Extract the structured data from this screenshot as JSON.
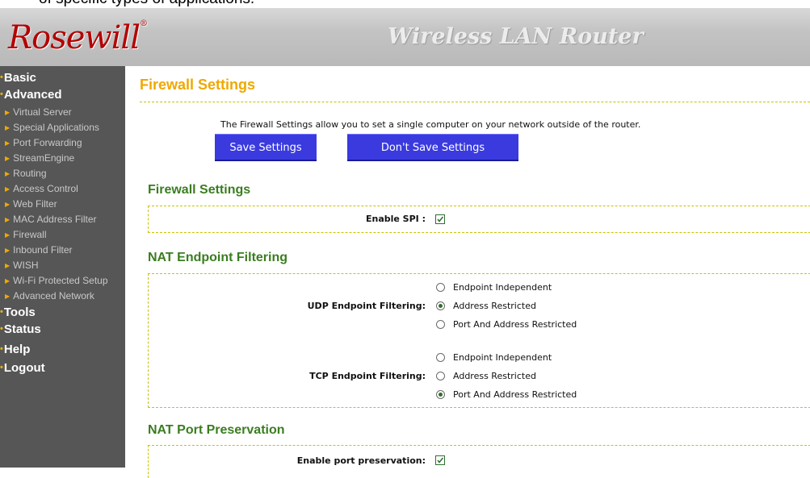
{
  "doc_text": "of specific types of applications.",
  "header": {
    "logo": "Rosewill",
    "logo_mark": "®",
    "title": "Wireless LAN Router"
  },
  "sidebar": {
    "main_items": [
      "Basic",
      "Advanced",
      "Tools",
      "Status",
      "Help",
      "Logout"
    ],
    "sub_items": [
      "Virtual Server",
      "Special Applications",
      "Port Forwarding",
      "StreamEngine",
      "Routing",
      "Access Control",
      "Web Filter",
      "MAC Address Filter",
      "Firewall",
      "Inbound Filter",
      "WISH",
      "Wi-Fi Protected Setup",
      "Advanced Network"
    ]
  },
  "page": {
    "title": "Firewall Settings",
    "description": "The Firewall Settings allow you to set a single computer on your network outside of the router.",
    "save_button": "Save Settings",
    "dont_save_button": "Don't Save Settings"
  },
  "firewall": {
    "heading": "Firewall Settings",
    "spi_label": "Enable SPI :",
    "spi_checked": true
  },
  "nat_filtering": {
    "heading": "NAT Endpoint Filtering",
    "udp_label": "UDP Endpoint Filtering:",
    "tcp_label": "TCP Endpoint Filtering:",
    "options": [
      "Endpoint Independent",
      "Address Restricted",
      "Port And Address Restricted"
    ],
    "udp_selected": "Address Restricted",
    "tcp_selected": "Port And Address Restricted"
  },
  "port_preservation": {
    "heading": "NAT Port Preservation",
    "label": "Enable port preservation:",
    "checked": true
  }
}
